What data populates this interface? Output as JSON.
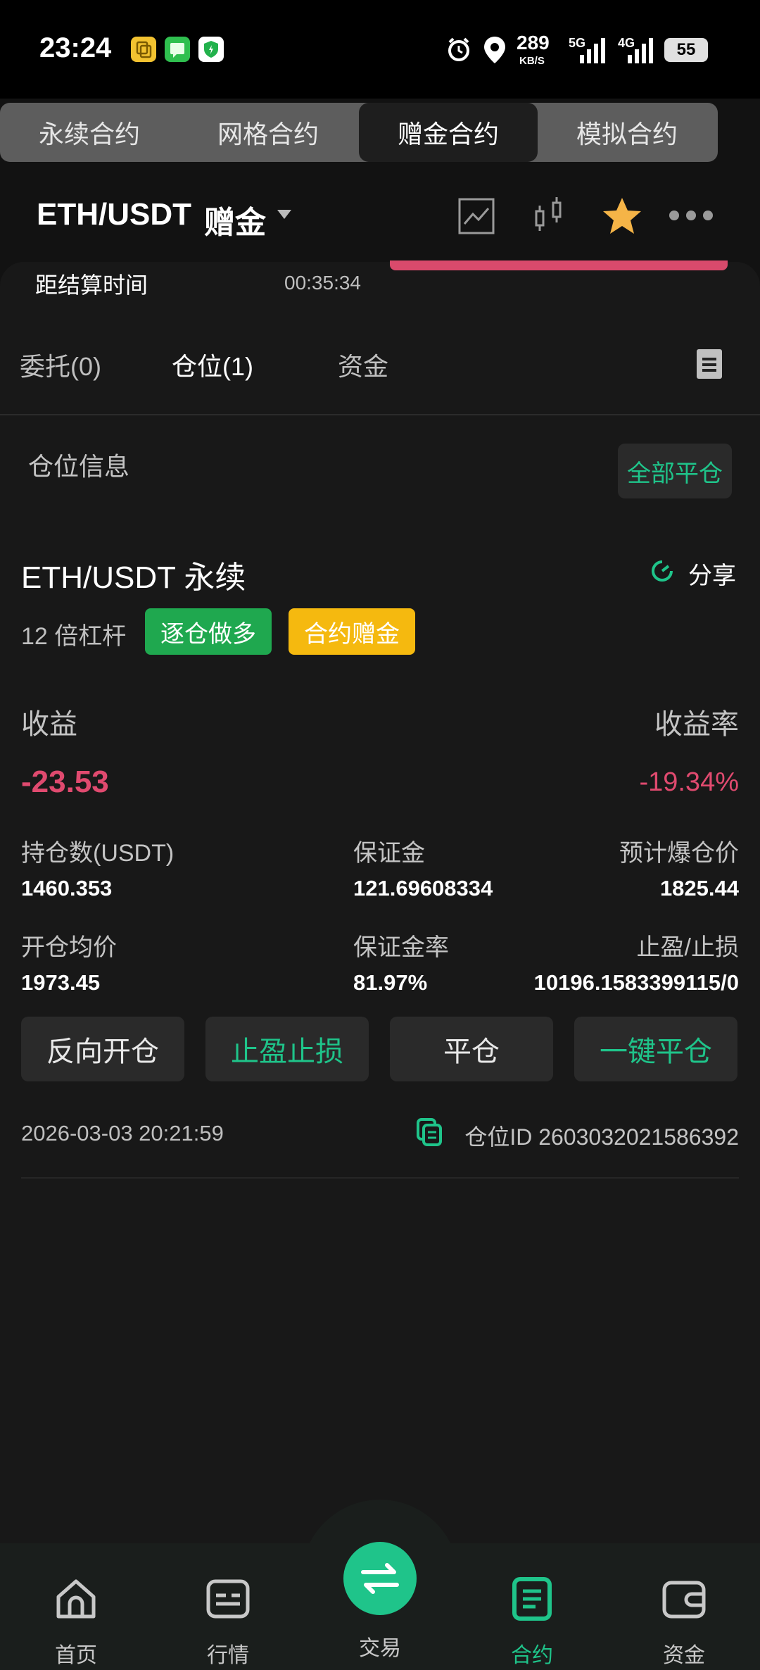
{
  "status_bar": {
    "time": "23:24",
    "net_speed": "289",
    "net_unit": "KB/S",
    "net_5g": "5G",
    "net_4g": "4G",
    "battery": "55"
  },
  "top_tabs": [
    "永续合约",
    "网格合约",
    "赠金合约",
    "模拟合约"
  ],
  "header": {
    "pair": "ETH/USDT",
    "pair_suffix": "赠金"
  },
  "countdown": {
    "label": "距结算时间",
    "value": "00:35:34"
  },
  "sub_tabs": [
    "委托(0)",
    "仓位(1)",
    "资金"
  ],
  "position_info": {
    "title": "仓位信息",
    "close_all": "全部平仓"
  },
  "position": {
    "symbol": "ETH/USDT 永续",
    "share": "分享",
    "leverage": "12 倍杠杆",
    "tag_long": "逐仓做多",
    "tag_bonus": "合约赠金",
    "pnl_label": "收益",
    "pnl_value": "-23.53",
    "roi_label": "收益率",
    "roi_value": "-19.34%",
    "qty_label": "持仓数(USDT)",
    "qty_value": "1460.353",
    "margin_label": "保证金",
    "margin_value": "121.69608334",
    "liq_label": "预计爆仓价",
    "liq_value": "1825.44",
    "entry_label": "开仓均价",
    "entry_value": "1973.45",
    "margin_rate_label": "保证金率",
    "margin_rate_value": "81.97%",
    "tpsl_label": "止盈/止损",
    "tpsl_value": "10196.1583399115/0",
    "time": "2026-03-03 20:21:59",
    "pos_id": "仓位ID 2603032021586392"
  },
  "actions": [
    "反向开仓",
    "止盈止损",
    "平仓",
    "一键平仓"
  ],
  "bottom_nav": [
    {
      "label": "首页",
      "icon": "home-icon"
    },
    {
      "label": "行情",
      "icon": "market-icon"
    },
    {
      "label": "交易",
      "icon": "swap-icon"
    },
    {
      "label": "合约",
      "icon": "contract-icon"
    },
    {
      "label": "资金",
      "icon": "wallet-icon"
    }
  ],
  "colors": {
    "accent_green": "#1fc48a",
    "loss_red": "#e04a6f",
    "bonus_yellow": "#f5b90f",
    "long_green": "#1fa84f"
  }
}
